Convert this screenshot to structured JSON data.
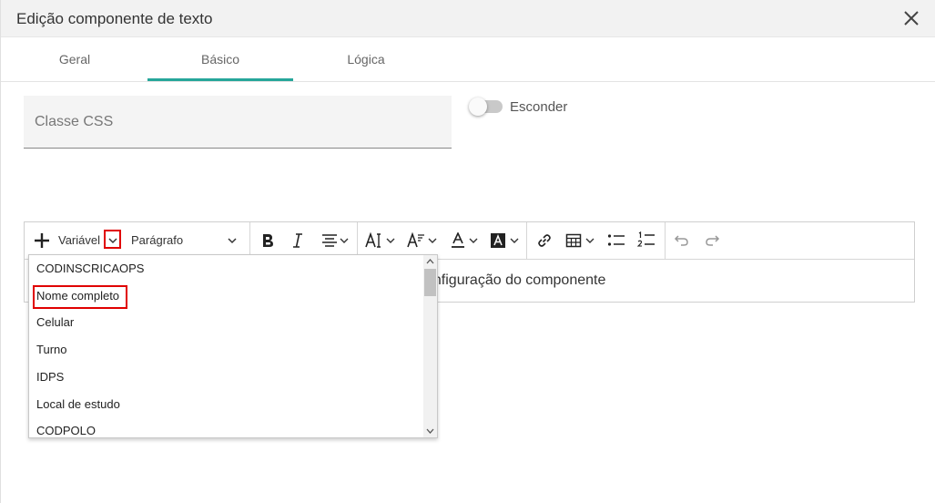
{
  "dialog": {
    "title": "Edição componente de texto"
  },
  "tabs": [
    {
      "label": "Geral"
    },
    {
      "label": "Básico"
    },
    {
      "label": "Lógica"
    }
  ],
  "form": {
    "css_placeholder": "Classe CSS",
    "css_value": "",
    "hide_label": "Esconder",
    "hide_on": false
  },
  "toolbar": {
    "variable_label": "Variável",
    "paragraph_label": "Parágrafo"
  },
  "editor": {
    "content_visible": "onfiguração do componente"
  },
  "dropdown": {
    "items": [
      "CODINSCRICAOPS",
      "Nome completo",
      "Celular",
      "Turno",
      "IDPS",
      "Local de estudo",
      "CODPOLO"
    ]
  },
  "colors": {
    "accent": "#26a69a",
    "highlight": "#e00000"
  }
}
